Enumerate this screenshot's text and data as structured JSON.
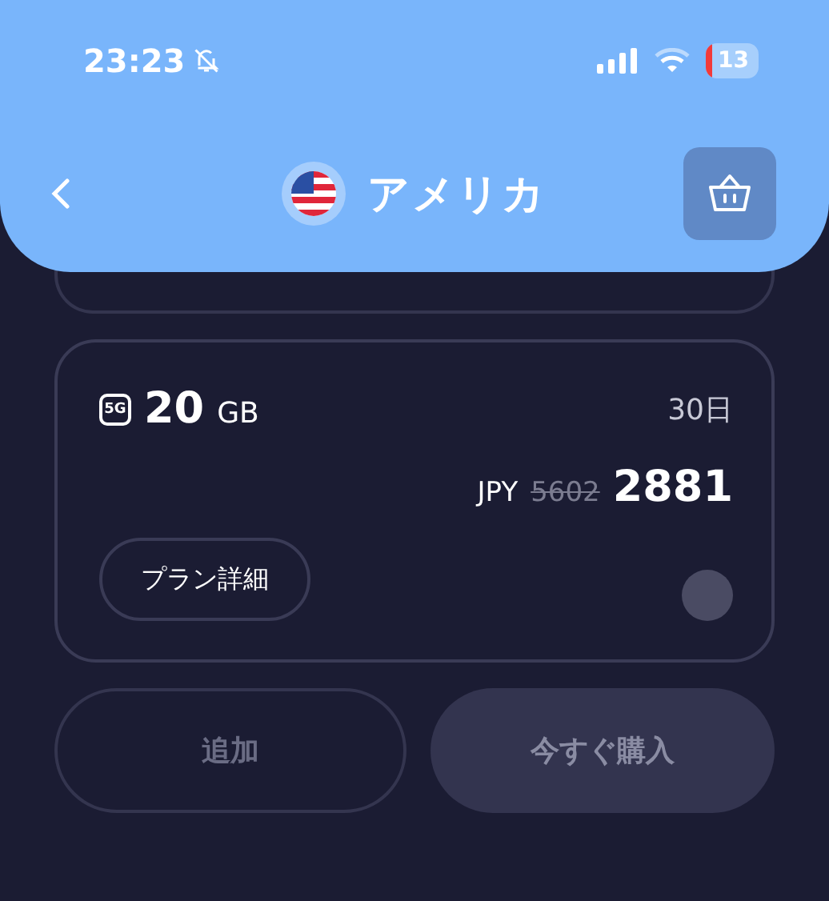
{
  "status_bar": {
    "time": "23:23",
    "silent": true,
    "battery": "13"
  },
  "header": {
    "title": "アメリカ"
  },
  "plan": {
    "network": "5G",
    "amount": "20",
    "unit": "GB",
    "duration": "30日",
    "currency": "JPY",
    "original_price": "5602",
    "price": "2881",
    "details_button": "プラン詳細",
    "selected": false
  },
  "actions": [
    {
      "label": "追加",
      "kind": "outline"
    },
    {
      "label": "今すぐ購入",
      "kind": "filled",
      "disabled": true
    }
  ]
}
